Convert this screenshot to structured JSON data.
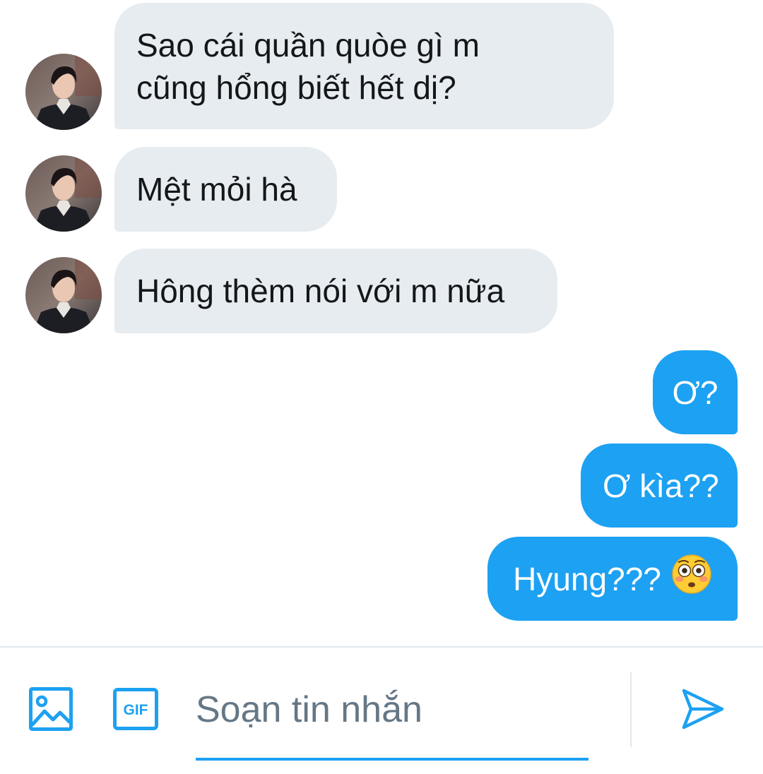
{
  "conversation": {
    "messages": [
      {
        "direction": "in",
        "text_line1": "Sao cái quần quòe gì m",
        "text_line2": "cũng hổng biết hết dị?"
      },
      {
        "direction": "in",
        "text": "Mệt mỏi hà"
      },
      {
        "direction": "in",
        "text": "Hông thèm nói với m nữa"
      },
      {
        "direction": "out",
        "text": "Ơ?"
      },
      {
        "direction": "out",
        "text": "Ơ kìa??"
      },
      {
        "direction": "out",
        "text": "Hyung???",
        "emoji": "flushed-face"
      }
    ]
  },
  "composer": {
    "placeholder": "Soạn tin nhắn",
    "gif_label": "GIF",
    "icons": [
      "image-icon",
      "gif-icon",
      "send-icon"
    ]
  },
  "colors": {
    "accent": "#1da1f2",
    "incoming_bubble": "#e6ecf0",
    "incoming_text": "#14171a",
    "placeholder_text": "#657786"
  }
}
